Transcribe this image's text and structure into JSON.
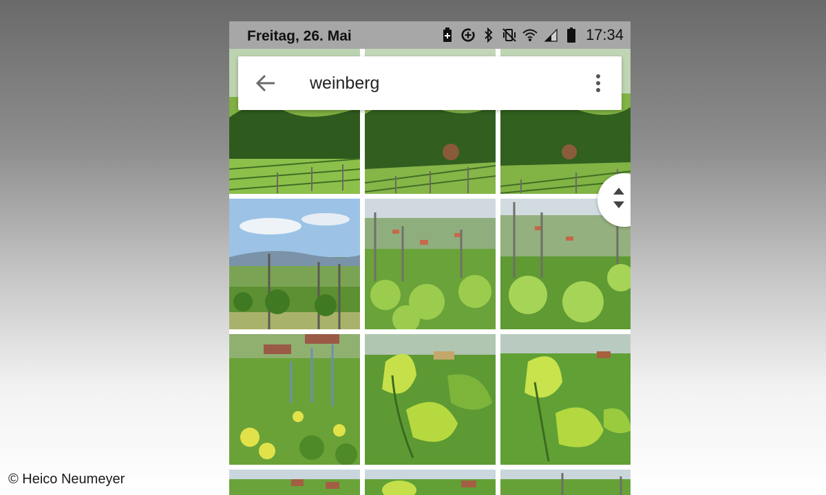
{
  "status_bar": {
    "date": "Freitag, 26. Mai",
    "time": "17:34",
    "icons": [
      "battery-saver-icon",
      "data-saver-icon",
      "bluetooth-icon",
      "vibrate-icon",
      "wifi-icon",
      "signal-icon",
      "battery-icon"
    ]
  },
  "search": {
    "query": "weinberg",
    "back_icon": "arrow-back-icon",
    "menu_icon": "more-vert-icon"
  },
  "results": {
    "thumbnails": [
      {
        "subject": "vineyard-rows-forest"
      },
      {
        "subject": "vineyard-rows-forest"
      },
      {
        "subject": "vineyard-rows-forest"
      },
      {
        "subject": "vineyard-valley-view"
      },
      {
        "subject": "vine-leaves-village"
      },
      {
        "subject": "vine-leaves-village"
      },
      {
        "subject": "vineyard-flowers-houses"
      },
      {
        "subject": "vine-leaf-closeup"
      },
      {
        "subject": "vine-leaf-closeup"
      },
      {
        "subject": "vineyard-village"
      },
      {
        "subject": "vineyard-village"
      },
      {
        "subject": "vineyard-village"
      }
    ]
  },
  "scroll_handle_icon": "fast-scroll-icon",
  "copyright": "© Heico Neumeyer"
}
